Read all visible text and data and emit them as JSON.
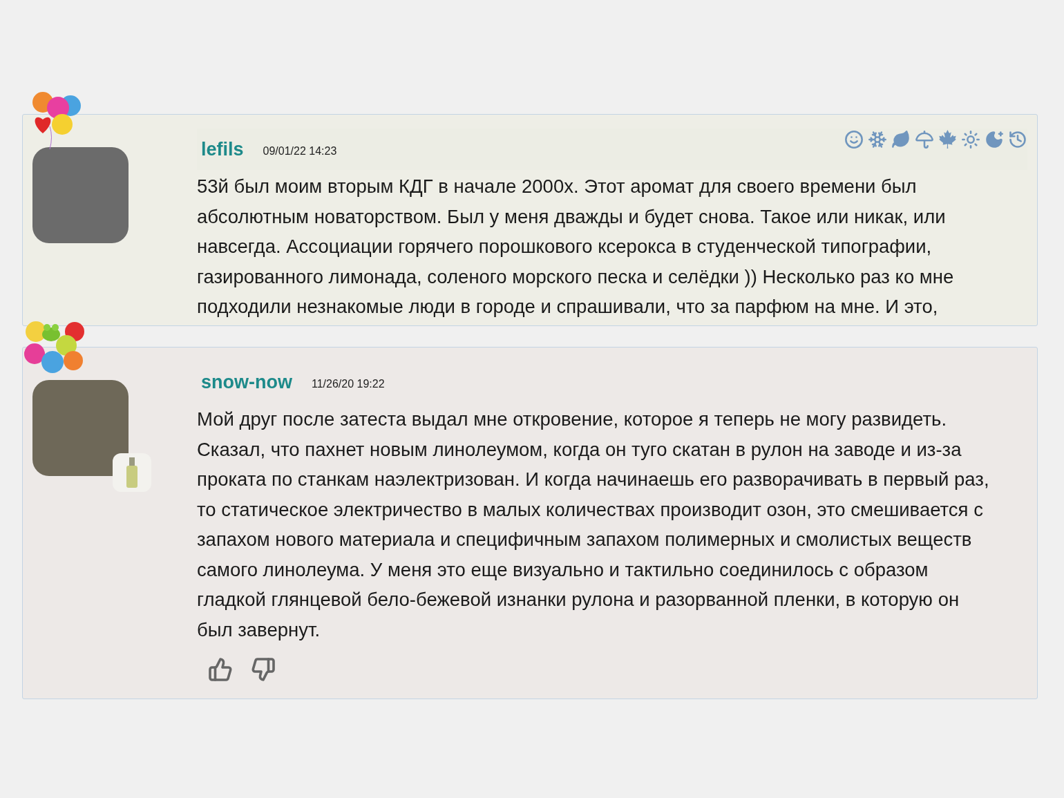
{
  "comments": [
    {
      "username": "lefils",
      "date": "09/01/22 14:23",
      "kind": "seasons",
      "perfume_badge": false,
      "balloons": {
        "kind": "hearts"
      },
      "text_lines": [
        "53й был моим вторым КДГ в начале 2000х. Этот аромат для своего времени был",
        "абсолютным новаторством. Был у меня дважды и будет снова. Такое или никак, или",
        "навсегда. Ассоциации горячего порошкового ксерокса в студенческой типографии,",
        "газированного лимонада, соленого морского песка и селёдки )) Несколько раз ко мне",
        "подходили незнакомые люди в городе и спрашивали, что за парфюм на мне. И это,"
      ]
    },
    {
      "username": "snow-now",
      "date": "11/26/20 19:22",
      "kind": "votes",
      "perfume_badge": true,
      "balloons": {
        "kind": "frog"
      },
      "text_lines": [
        "Мой друг после затеста выдал мне откровение, которое я теперь не могу развидеть.",
        "Сказал, что пахнет новым линолеумом, когда он туго скатан в рулон на заводе и из-за",
        "проката по станкам наэлектризован. И когда начинаешь его разворачивать в первый раз,",
        "то статическое электричество в малых количествах производит озон, это смешивается с",
        "запахом нового материала и специфичным запахом полимерных и смолистых веществ",
        "самого линолеума. У меня это еще визуально и тактильно соединилось с образом",
        "гладкой глянцевой бело-бежевой изнанки рулона и разорванной пленки, в которую он",
        "был завернут."
      ]
    }
  ]
}
